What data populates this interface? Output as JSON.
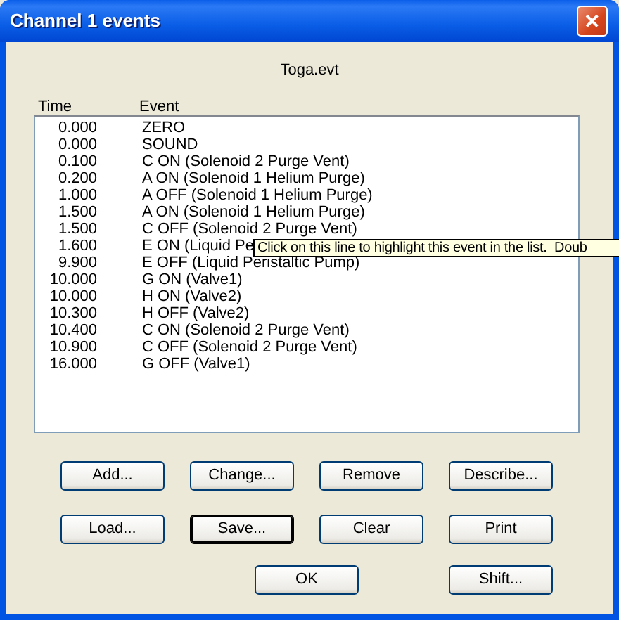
{
  "window": {
    "title": "Channel 1 events",
    "close": "✕"
  },
  "file_name": "Toga.evt",
  "columns": [
    "Time",
    "Event"
  ],
  "rows": [
    {
      "time": "0.000",
      "event": "ZERO"
    },
    {
      "time": "0.000",
      "event": "SOUND"
    },
    {
      "time": "0.100",
      "event": "C ON (Solenoid 2 Purge Vent)"
    },
    {
      "time": "0.200",
      "event": "A ON (Solenoid 1 Helium Purge)"
    },
    {
      "time": "1.000",
      "event": "A OFF (Solenoid 1 Helium Purge)"
    },
    {
      "time": "1.500",
      "event": "A ON (Solenoid 1 Helium Purge)"
    },
    {
      "time": "1.500",
      "event": "C OFF (Solenoid 2 Purge Vent)"
    },
    {
      "time": "1.600",
      "event": "E ON (Liquid Pe"
    },
    {
      "time": "9.900",
      "event": "E OFF (Liquid Peristaltic Pump)"
    },
    {
      "time": "10.000",
      "event": "G ON (Valve1)"
    },
    {
      "time": "10.000",
      "event": "H ON (Valve2)"
    },
    {
      "time": "10.300",
      "event": "H OFF (Valve2)"
    },
    {
      "time": "10.400",
      "event": "C ON (Solenoid 2 Purge Vent)"
    },
    {
      "time": "10.900",
      "event": "C OFF (Solenoid 2 Purge Vent)"
    },
    {
      "time": "16.000",
      "event": "G OFF (Valve1)"
    }
  ],
  "tooltip": "Click on this line to highlight this event in the list.  Doub",
  "button_rows": [
    [
      {
        "label": "Add...",
        "focused": false
      },
      {
        "label": "Change...",
        "focused": false
      },
      {
        "label": "Remove",
        "focused": false
      },
      {
        "label": "Describe...",
        "focused": false
      }
    ],
    [
      {
        "label": "Load...",
        "focused": false
      },
      {
        "label": "Save...",
        "focused": true
      },
      {
        "label": "Clear",
        "focused": false
      },
      {
        "label": "Print",
        "focused": false
      }
    ],
    [
      {
        "label": "OK",
        "focused": false
      },
      {
        "label": "Shift...",
        "focused": false
      }
    ]
  ]
}
